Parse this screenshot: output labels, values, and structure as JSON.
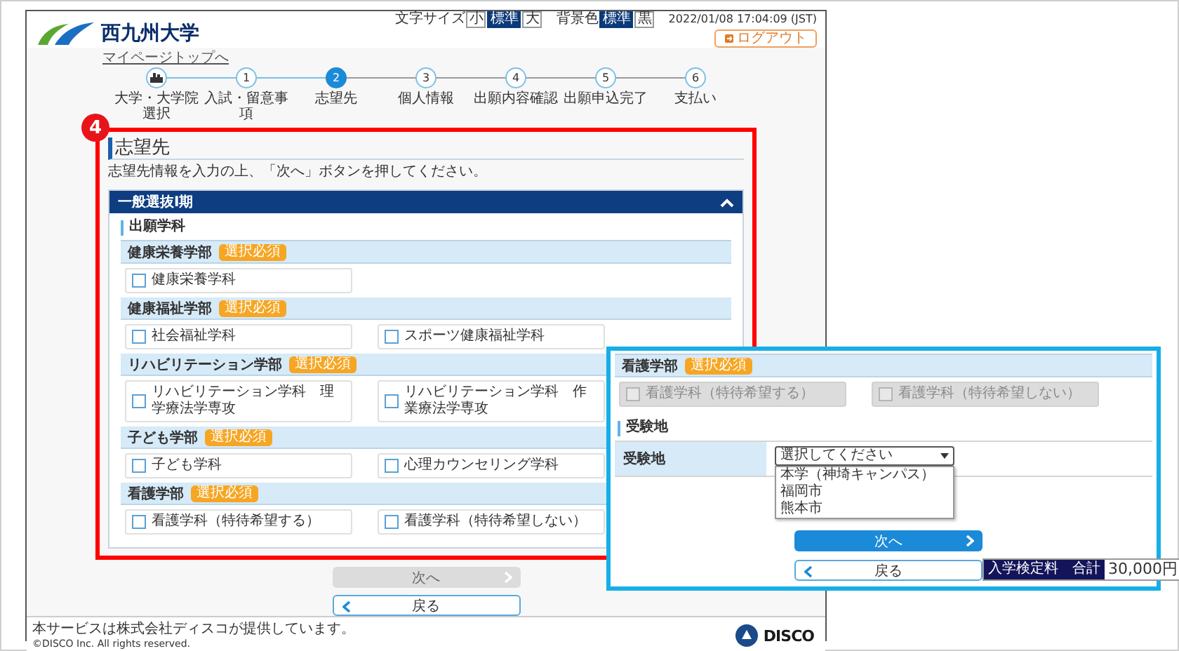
{
  "header": {
    "logo": "西九州大学",
    "font_size": {
      "label": "文字サイズ",
      "options": [
        {
          "label": "小",
          "selected": false
        },
        {
          "label": "標準",
          "selected": true
        },
        {
          "label": "大",
          "selected": false
        }
      ]
    },
    "color_scheme": {
      "label": "背景色",
      "options": [
        {
          "label": "標準",
          "selected": true
        },
        {
          "label": "黒",
          "selected": false
        }
      ]
    },
    "datetime": "2022/01/08 17:04:09 (JST)",
    "logout": "ログアウト"
  },
  "breadcrumb": "マイページトップへ",
  "steps": [
    {
      "kind": "icon",
      "label": "大学・大学院選択",
      "selected": false
    },
    {
      "kind": "number",
      "number": "1",
      "label": "入試・留意事項",
      "selected": false
    },
    {
      "kind": "number",
      "number": "2",
      "label": "志望先",
      "selected": true
    },
    {
      "kind": "number",
      "number": "3",
      "label": "個人情報",
      "selected": false
    },
    {
      "kind": "number",
      "number": "4",
      "label": "出願内容確認",
      "selected": false
    },
    {
      "kind": "number",
      "number": "5",
      "label": "出願申込完了",
      "selected": false
    },
    {
      "kind": "number",
      "number": "6",
      "label": "支払い",
      "selected": false
    }
  ],
  "annotation": {
    "number": "4"
  },
  "page": {
    "title": "志望先",
    "instruction": "志望先情報を入力の上、「次へ」ボタンを押してください。",
    "panel": {
      "title": "一般選抜I期",
      "expanded": true,
      "section": "出願学科",
      "groups": [
        {
          "name": "健康栄養学部",
          "badge": "選択必須",
          "options": [
            {
              "label": "健康栄養学科",
              "checked": false,
              "disabled": false
            }
          ]
        },
        {
          "name": "健康福祉学部",
          "badge": "選択必須",
          "options": [
            {
              "label": "社会福祉学科",
              "checked": false,
              "disabled": false
            },
            {
              "label": "スポーツ健康福祉学科",
              "checked": false,
              "disabled": false
            }
          ]
        },
        {
          "name": "リハビリテーション学部",
          "badge": "選択必須",
          "options": [
            {
              "label": "リハビリテーション学科　理学療法学専攻",
              "checked": false,
              "disabled": false
            },
            {
              "label": "リハビリテーション学科　作業療法学専攻",
              "checked": false,
              "disabled": false
            }
          ]
        },
        {
          "name": "子ども学部",
          "badge": "選択必須",
          "options": [
            {
              "label": "子ども学科",
              "checked": false,
              "disabled": false
            },
            {
              "label": "心理カウンセリング学科",
              "checked": false,
              "disabled": false
            }
          ]
        },
        {
          "name": "看護学部",
          "badge": "選択必須",
          "options": [
            {
              "label": "看護学科（特待希望する）",
              "checked": false,
              "disabled": false
            },
            {
              "label": "看護学科（特待希望しない）",
              "checked": false,
              "disabled": false
            }
          ]
        }
      ]
    }
  },
  "buttons": {
    "next": {
      "label": "次へ",
      "disabled": true
    },
    "back": "戻る"
  },
  "footer": {
    "notice": "本サービスは株式会社ディスコが提供しています。",
    "copyright": "©DISCO Inc. All rights reserved.",
    "brand": "DISCO"
  },
  "callout": {
    "group": {
      "name": "看護学部",
      "badge": "選択必須",
      "options": [
        {
          "label": "看護学科（特待希望する）",
          "checked": false,
          "disabled": true
        },
        {
          "label": "看護学科（特待希望しない）",
          "checked": false,
          "disabled": true
        }
      ]
    },
    "section": "受験地",
    "field": {
      "label": "受験地",
      "value": "選択してください",
      "expanded": true,
      "options": [
        "本学（神埼キャンパス）",
        "福岡市",
        "熊本市"
      ]
    },
    "next": {
      "label": "次へ",
      "disabled": false
    },
    "back": "戻る",
    "fee": {
      "label": "入学検定料　合計",
      "amount": "30,000円"
    }
  }
}
